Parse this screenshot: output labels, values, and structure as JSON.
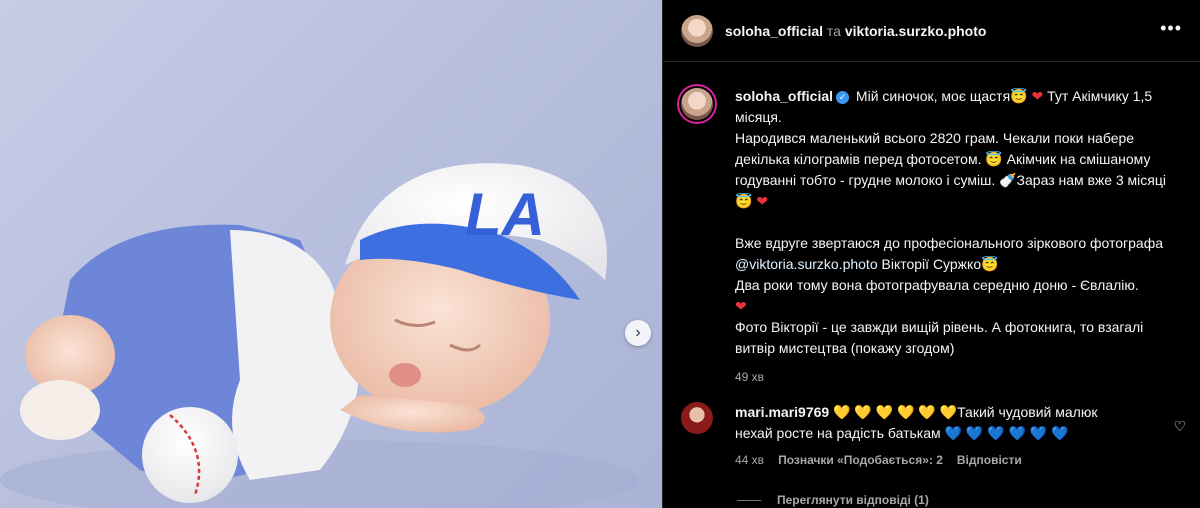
{
  "header": {
    "user": "soloha_official",
    "connector": "та",
    "collab": "viktoria.surzko.photo",
    "more_icon": "more-horizontal-icon"
  },
  "caption": {
    "user": "soloha_official",
    "line1": "Мій синочок, моє щастя😇",
    "line1b": "Тут Акімчику 1,5 місяця.",
    "p1": "Народився маленький всього 2820 грам. Чекали поки набере декілька кілограмів перед фотосетом. 😇 Акімчик на смішаному годуванні тобто - грудне молоко і суміш. 🍼Зараз нам вже 3 місяці😇",
    "p2a": "Вже вдруге звертаюся до професіонального зіркового фотографа ",
    "p2_link": "@viktoria.surzko.photo",
    "p2b": " Вікторії Суржко😇",
    "p3": "Два роки тому вона фотографувала середню доню - Євлалію.",
    "p4": "Фото Вікторії - це завжди вищій рівень. А фотокнига, то взагалі витвір мистецтва (покажу згодом)",
    "time": "49 хв"
  },
  "comment": {
    "user": "mari.mari9769",
    "text": "💛 💛 💛 💛 💛 💛Такий чудовий малюк нехай росте на радість батькам 💙 💙 💙 💙 💙 💙",
    "time": "44 хв",
    "likes": "Позначки «Подобається»: 2",
    "reply": "Відповісти"
  },
  "view_replies": "Переглянути відповіді (1)",
  "photo": {
    "next_icon": "chevron-right-icon"
  }
}
